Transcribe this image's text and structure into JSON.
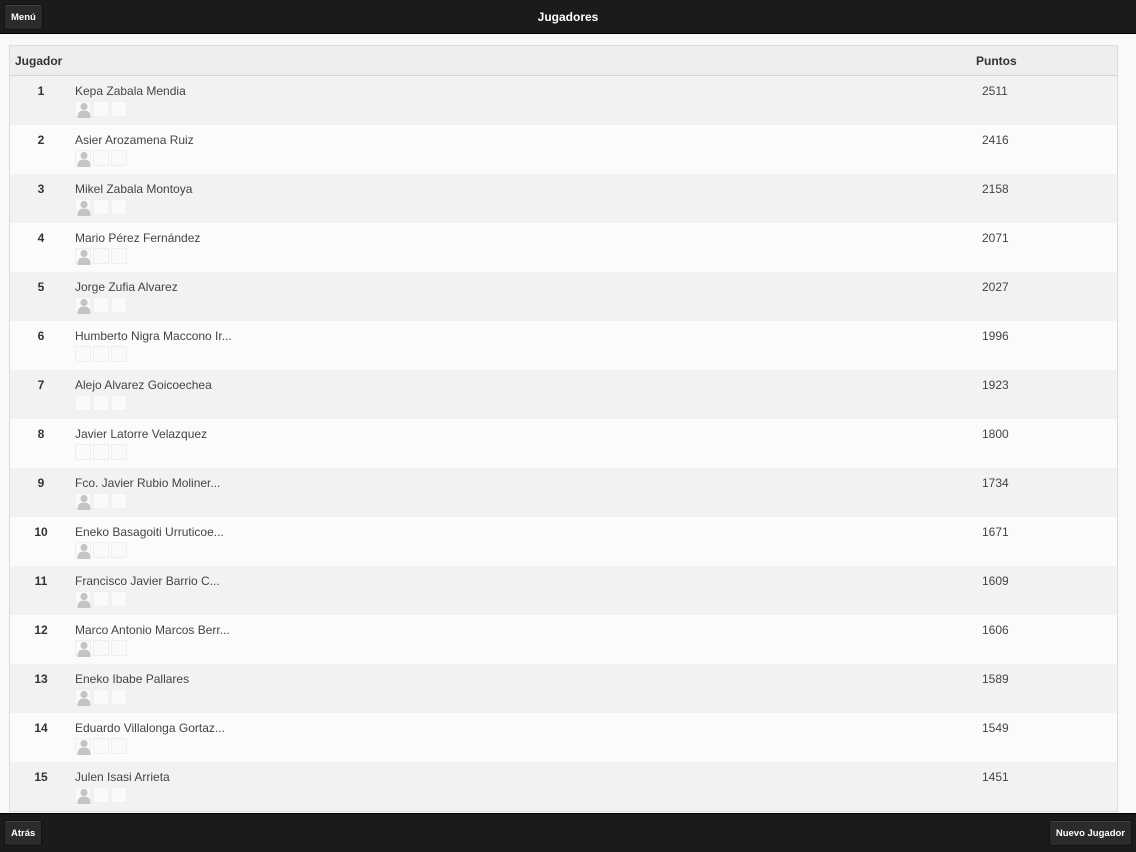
{
  "header": {
    "title": "Jugadores",
    "menu_label": "Menú"
  },
  "footer": {
    "back_label": "Atrás",
    "new_player_label": "Nuevo Jugador"
  },
  "table": {
    "col_player": "Jugador",
    "col_points": "Puntos",
    "rows": [
      {
        "rank": "1",
        "name": "Kepa Zabala Mendia",
        "points": "2511",
        "avatar": true
      },
      {
        "rank": "2",
        "name": "Asier Arozamena Ruiz",
        "points": "2416",
        "avatar": true
      },
      {
        "rank": "3",
        "name": "Mikel Zabala Montoya",
        "points": "2158",
        "avatar": true
      },
      {
        "rank": "4",
        "name": "Mario Pérez Fernández",
        "points": "2071",
        "avatar": true
      },
      {
        "rank": "5",
        "name": "Jorge Zufia Alvarez",
        "points": "2027",
        "avatar": true
      },
      {
        "rank": "6",
        "name": "Humberto Nigra Maccono Ir...",
        "points": "1996",
        "avatar": false
      },
      {
        "rank": "7",
        "name": "Alejo Alvarez Goicoechea",
        "points": "1923",
        "avatar": false
      },
      {
        "rank": "8",
        "name": "Javier Latorre Velazquez",
        "points": "1800",
        "avatar": false
      },
      {
        "rank": "9",
        "name": "Fco. Javier Rubio Moliner...",
        "points": "1734",
        "avatar": true
      },
      {
        "rank": "10",
        "name": "Eneko Basagoiti Urruticoe...",
        "points": "1671",
        "avatar": true
      },
      {
        "rank": "11",
        "name": "Francisco Javier Barrio C...",
        "points": "1609",
        "avatar": true
      },
      {
        "rank": "12",
        "name": "Marco Antonio Marcos Berr...",
        "points": "1606",
        "avatar": true
      },
      {
        "rank": "13",
        "name": "Eneko Ibabe Pallares",
        "points": "1589",
        "avatar": true
      },
      {
        "rank": "14",
        "name": "Eduardo Villalonga Gortaz...",
        "points": "1549",
        "avatar": true
      },
      {
        "rank": "15",
        "name": "Julen Isasi Arrieta",
        "points": "1451",
        "avatar": true
      }
    ]
  },
  "colors": {
    "bar": "#1b1b1b",
    "header_row": "#eeeeee",
    "avatar": "#c4c4c4"
  },
  "icons": {
    "avatar": "user-silhouette-icon"
  }
}
